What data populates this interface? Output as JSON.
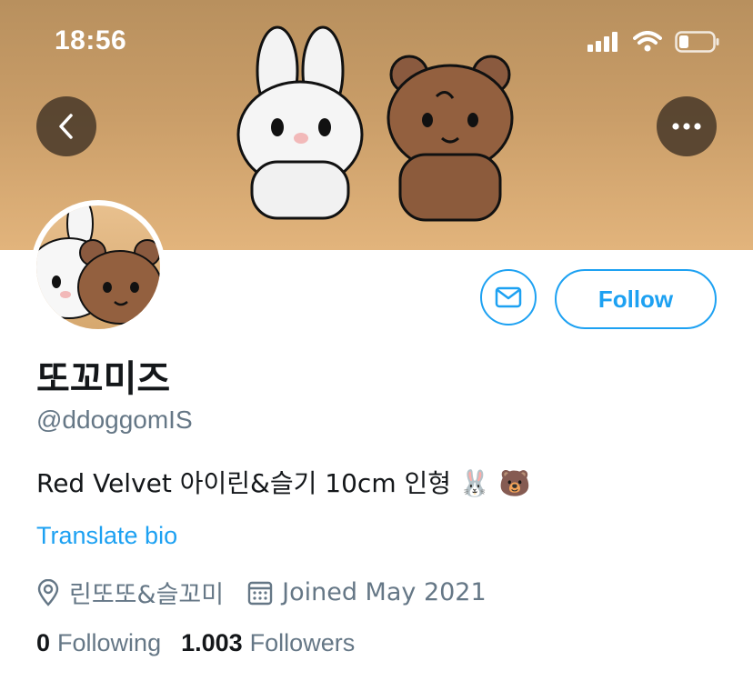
{
  "status_bar": {
    "time": "18:56"
  },
  "profile": {
    "display_name": "또꼬미즈",
    "handle": "@ddoggomIS",
    "bio": "Red Velvet 아이린&슬기 10cm 인형 🐰 🐻",
    "translate_label": "Translate bio",
    "location": "린또또&슬꼬미",
    "joined": "Joined May 2021",
    "following_count": "0",
    "following_label": "Following",
    "followers_count": "1.003",
    "followers_label": "Followers"
  },
  "actions": {
    "follow_label": "Follow"
  },
  "icons": {
    "back": "chevron-left-icon",
    "more": "more-horizontal-icon",
    "message": "mail-icon",
    "location": "location-pin-icon",
    "calendar": "calendar-icon"
  },
  "colors": {
    "accent": "#1da1f2",
    "secondary_text": "#657786",
    "banner": "#c99d68"
  }
}
